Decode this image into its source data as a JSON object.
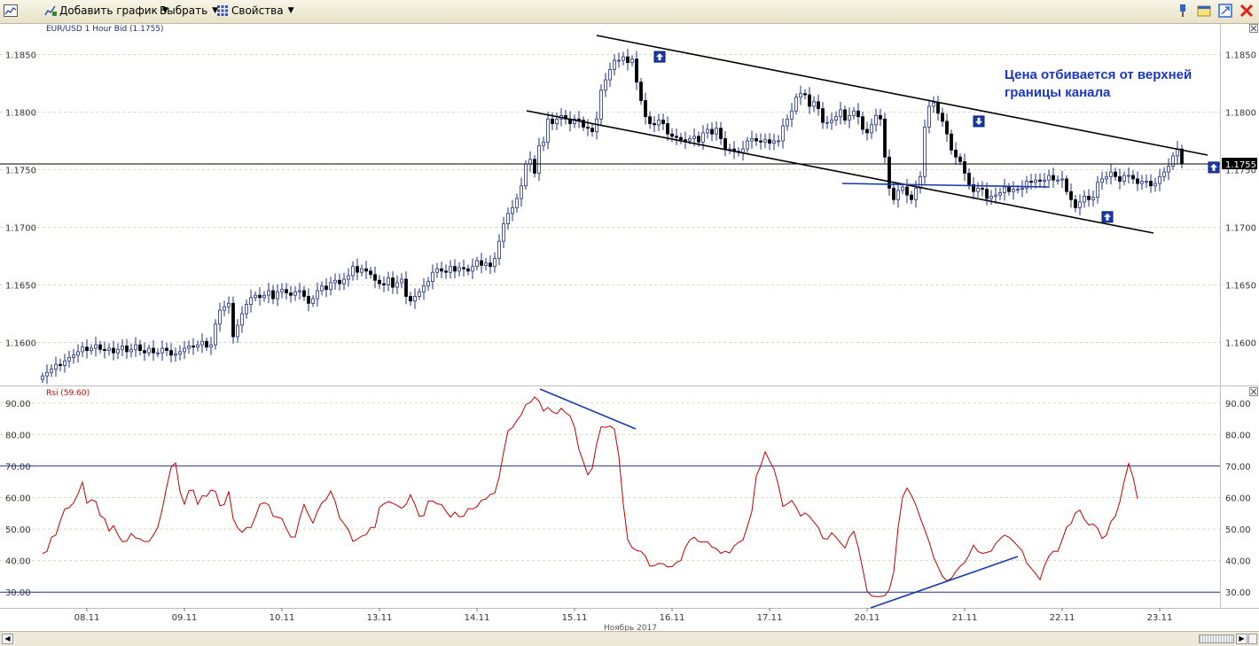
{
  "toolbar": {
    "add_chart": "Добавить график",
    "select": "Выбрать",
    "properties": "Свойства"
  },
  "chart_data": [
    {
      "type": "candlestick",
      "title": "EUR/USD 1 Hour Bid (1.1755)",
      "annotation": "Цена отбивается от верхней\nграницы канала",
      "annotation_line1": "Цена отбивается от верхней",
      "annotation_line2": "границы канала",
      "current_price_label": "1.1755",
      "y_ticks": [
        "1.1850",
        "1.1800",
        "1.1750",
        "1.1700",
        "1.1650",
        "1.1600"
      ],
      "y_tick_values": [
        1.185,
        1.18,
        1.175,
        1.17,
        1.165,
        1.16
      ],
      "ylim": [
        1.1565,
        1.1875
      ],
      "x_ticks": [
        "08.11",
        "09.11",
        "10.11",
        "13.11",
        "14.11",
        "15.11",
        "16.11",
        "17.11",
        "20.11",
        "21.11",
        "22.11",
        "23.11"
      ],
      "x_tick_index": [
        10,
        32,
        54,
        76,
        98,
        120,
        142,
        164,
        186,
        208,
        230,
        252
      ],
      "x_axis_caption": "Ноябрь 2017",
      "close": [
        1.1571,
        1.1574,
        1.1577,
        1.1581,
        1.158,
        1.1584,
        1.1587,
        1.1589,
        1.1592,
        1.1596,
        1.1593,
        1.1595,
        1.1598,
        1.1594,
        1.1593,
        1.1595,
        1.1591,
        1.1594,
        1.1597,
        1.1592,
        1.1594,
        1.1598,
        1.1593,
        1.1591,
        1.1595,
        1.1591,
        1.1591,
        1.1595,
        1.1593,
        1.1589,
        1.159,
        1.1592,
        1.1595,
        1.1597,
        1.1596,
        1.1598,
        1.1601,
        1.1596,
        1.1598,
        1.1616,
        1.1628,
        1.1631,
        1.1634,
        1.1605,
        1.1615,
        1.1625,
        1.1633,
        1.1639,
        1.1641,
        1.1639,
        1.1641,
        1.1645,
        1.1638,
        1.1644,
        1.1646,
        1.1643,
        1.1641,
        1.1644,
        1.1645,
        1.164,
        1.1634,
        1.1638,
        1.1645,
        1.1649,
        1.1646,
        1.1652,
        1.1654,
        1.1651,
        1.1655,
        1.1658,
        1.1666,
        1.1661,
        1.1664,
        1.1662,
        1.1659,
        1.1654,
        1.1651,
        1.165,
        1.1656,
        1.1648,
        1.1652,
        1.1655,
        1.164,
        1.1636,
        1.164,
        1.1644,
        1.1649,
        1.1653,
        1.1661,
        1.1664,
        1.1662,
        1.1661,
        1.1666,
        1.1662,
        1.1665,
        1.1664,
        1.1662,
        1.1666,
        1.1671,
        1.1667,
        1.1669,
        1.1666,
        1.1673,
        1.1688,
        1.1703,
        1.1712,
        1.1717,
        1.1725,
        1.1736,
        1.1755,
        1.1759,
        1.1747,
        1.1771,
        1.1774,
        1.1794,
        1.179,
        1.1794,
        1.1797,
        1.1794,
        1.179,
        1.1794,
        1.1793,
        1.1787,
        1.1786,
        1.1783,
        1.1794,
        1.1819,
        1.1828,
        1.1837,
        1.1845,
        1.1845,
        1.1848,
        1.1843,
        1.1846,
        1.1826,
        1.181,
        1.1796,
        1.179,
        1.1789,
        1.1793,
        1.179,
        1.1781,
        1.1779,
        1.1778,
        1.1776,
        1.1775,
        1.1777,
        1.1779,
        1.1774,
        1.1782,
        1.1785,
        1.1781,
        1.1786,
        1.1777,
        1.1768,
        1.1768,
        1.1766,
        1.1765,
        1.1768,
        1.1775,
        1.1777,
        1.1775,
        1.1774,
        1.1776,
        1.1773,
        1.1775,
        1.1775,
        1.1788,
        1.1794,
        1.1801,
        1.1813,
        1.1816,
        1.1815,
        1.1805,
        1.1809,
        1.1803,
        1.1791,
        1.1791,
        1.1793,
        1.1796,
        1.1802,
        1.1793,
        1.1797,
        1.1801,
        1.1796,
        1.1785,
        1.1782,
        1.1789,
        1.1797,
        1.1794,
        1.1761,
        1.1734,
        1.1724,
        1.1732,
        1.1735,
        1.1728,
        1.1724,
        1.1734,
        1.1744,
        1.1787,
        1.1805,
        1.1808,
        1.1799,
        1.1792,
        1.1781,
        1.1767,
        1.1761,
        1.1757,
        1.1747,
        1.1737,
        1.1731,
        1.1734,
        1.1733,
        1.1725,
        1.1727,
        1.1728,
        1.173,
        1.1735,
        1.1731,
        1.1733,
        1.1733,
        1.1734,
        1.174,
        1.1739,
        1.1741,
        1.174,
        1.1741,
        1.1745,
        1.1741,
        1.1741,
        1.1742,
        1.1731,
        1.1724,
        1.1717,
        1.1722,
        1.1727,
        1.1724,
        1.1726,
        1.1739,
        1.1742,
        1.1744,
        1.1748,
        1.1744,
        1.174,
        1.1745,
        1.1745,
        1.1742,
        1.1738,
        1.174,
        1.174,
        1.1736,
        1.1738,
        1.1744,
        1.1748,
        1.1753,
        1.1762,
        1.1768,
        1.1755
      ],
      "highlight_signals": [
        {
          "index": 138,
          "dir": "up",
          "price": 1.1848
        },
        {
          "index": 210,
          "dir": "down",
          "price": 1.1792
        },
        {
          "index": 239,
          "dir": "up",
          "price": 1.1709
        },
        {
          "index": 263,
          "dir": "up",
          "price": 1.1752
        }
      ]
    },
    {
      "type": "line",
      "title": "Rsi (59.60)",
      "series_name": "Rsi",
      "y_ticks": [
        "90.00",
        "80.00",
        "70.00",
        "60.00",
        "50.00",
        "40.00",
        "30.00"
      ],
      "y_tick_values": [
        90,
        80,
        70,
        60,
        50,
        40,
        30
      ],
      "ylim": [
        25,
        95
      ],
      "levels": [
        70,
        30
      ],
      "values": [
        42.3,
        42.9,
        47.4,
        48.1,
        52.6,
        56.4,
        56.8,
        58.3,
        61.2,
        64.9,
        58.2,
        59.3,
        58.8,
        54.3,
        53.3,
        49.4,
        51.1,
        48.2,
        46.0,
        46.2,
        48.6,
        47.2,
        46.9,
        46.0,
        46.1,
        48.1,
        50.6,
        56.3,
        63.4,
        69.6,
        71.0,
        61.9,
        57.9,
        62.2,
        62.4,
        57.8,
        60.6,
        60.4,
        62.4,
        62.0,
        57.4,
        57.8,
        62.0,
        53.3,
        50.4,
        49.0,
        50.5,
        50.5,
        53.8,
        57.8,
        58.4,
        57.7,
        54.1,
        53.8,
        53.3,
        50.1,
        47.5,
        47.5,
        53.4,
        57.8,
        54.5,
        51.9,
        55.6,
        58.3,
        59.5,
        62.1,
        58.8,
        53.5,
        51.7,
        49.8,
        46.1,
        46.8,
        47.8,
        48.2,
        50.5,
        50.5,
        56.9,
        58.0,
        58.7,
        58.2,
        57.5,
        56.6,
        57.8,
        60.9,
        57.8,
        54.0,
        54.3,
        58.9,
        58.9,
        58.0,
        57.8,
        55.7,
        53.8,
        55.4,
        53.9,
        54.1,
        56.5,
        56.4,
        57.1,
        59.2,
        59.5,
        61.0,
        61.4,
        66.5,
        74.4,
        81.2,
        82.2,
        84.4,
        86.3,
        89.5,
        90.1,
        91.9,
        90.6,
        87.4,
        88.6,
        87.2,
        86.6,
        88.3,
        86.9,
        85.9,
        82.3,
        75.2,
        71.3,
        67.2,
        69.3,
        77.1,
        82.5,
        82.3,
        82.7,
        81.7,
        73.1,
        58.0,
        46.6,
        44.1,
        43.2,
        42.9,
        41.4,
        38.2,
        38.4,
        39.1,
        39.0,
        38.0,
        38.1,
        39.4,
        40.1,
        44.2,
        46.5,
        47.4,
        46.0,
        45.9,
        46.0,
        44.3,
        43.8,
        42.3,
        43.0,
        42.4,
        44.6,
        45.8,
        46.5,
        50.9,
        55.6,
        66.9,
        70.1,
        74.5,
        71.6,
        69.0,
        63.9,
        57.2,
        58.0,
        59.1,
        56.9,
        54.1,
        55.1,
        54.0,
        52.2,
        50.5,
        47.1,
        46.8,
        48.8,
        47.4,
        45.7,
        44.0,
        47.5,
        49.3,
        44.2,
        37.3,
        30.3,
        28.8,
        28.6,
        28.6,
        28.9,
        30.8,
        36.3,
        50.5,
        60.1,
        63.0,
        60.7,
        57.6,
        53.5,
        49.8,
        45.9,
        41.1,
        38.0,
        35.0,
        33.6,
        34.4,
        36.5,
        38.2,
        39.4,
        41.8,
        44.9,
        42.9,
        42.3,
        42.6,
        43.0,
        45.4,
        46.9,
        48.1,
        47.4,
        46.1,
        44.6,
        43.1,
        39.2,
        37.6,
        35.9,
        33.9,
        38.3,
        41.4,
        43.0,
        42.9,
        46.6,
        50.6,
        51.7,
        55.2,
        56.0,
        53.1,
        51.3,
        51.6,
        50.3,
        47.0,
        48.1,
        52.4,
        54.1,
        58.6,
        65.2,
        70.8,
        66.5,
        59.6
      ]
    }
  ]
}
